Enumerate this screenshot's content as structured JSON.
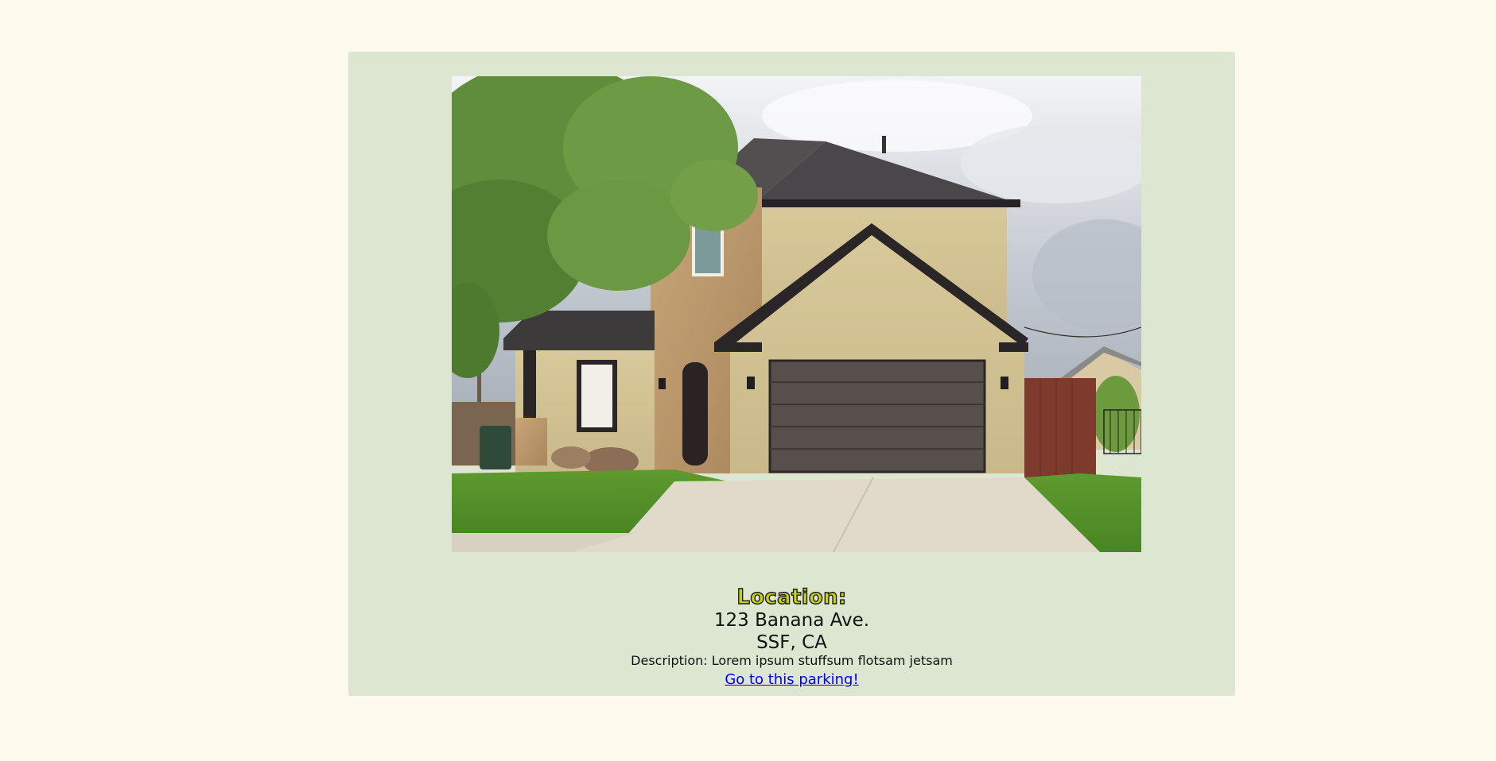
{
  "listing": {
    "image_alt": "House with driveway and garage",
    "location_label": "Location:",
    "address_line1": "123 Banana Ave.",
    "address_line2": "SSF, CA",
    "description": "Description: Lorem ipsum stuffsum flotsam jetsam",
    "link_label": "Go to this parking!"
  },
  "colors": {
    "page_background": "#fdf9ec",
    "card_background": "#dde6d1",
    "heading_fill": "#c8d21c",
    "link": "#0000ee"
  }
}
